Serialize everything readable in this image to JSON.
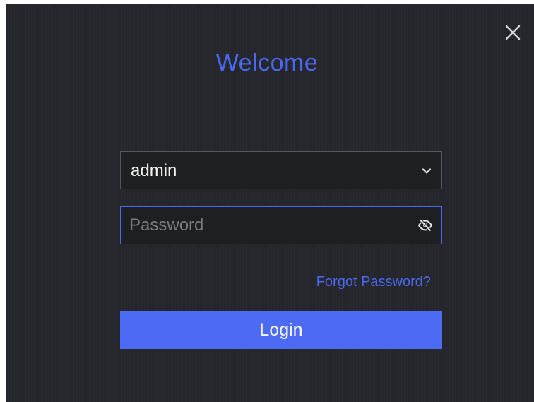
{
  "dialog": {
    "title": "Welcome",
    "close_icon": "close-icon"
  },
  "username": {
    "value": "admin",
    "dropdown_icon": "chevron-down-icon"
  },
  "password": {
    "placeholder": "Password",
    "value": "",
    "toggle_icon": "eye-slash-icon"
  },
  "links": {
    "forgot_password": "Forgot Password?"
  },
  "buttons": {
    "login": "Login"
  },
  "colors": {
    "accent": "#4a68f0",
    "button": "#4d6af5",
    "background": "#25262b",
    "field_background": "#1e1f23"
  }
}
